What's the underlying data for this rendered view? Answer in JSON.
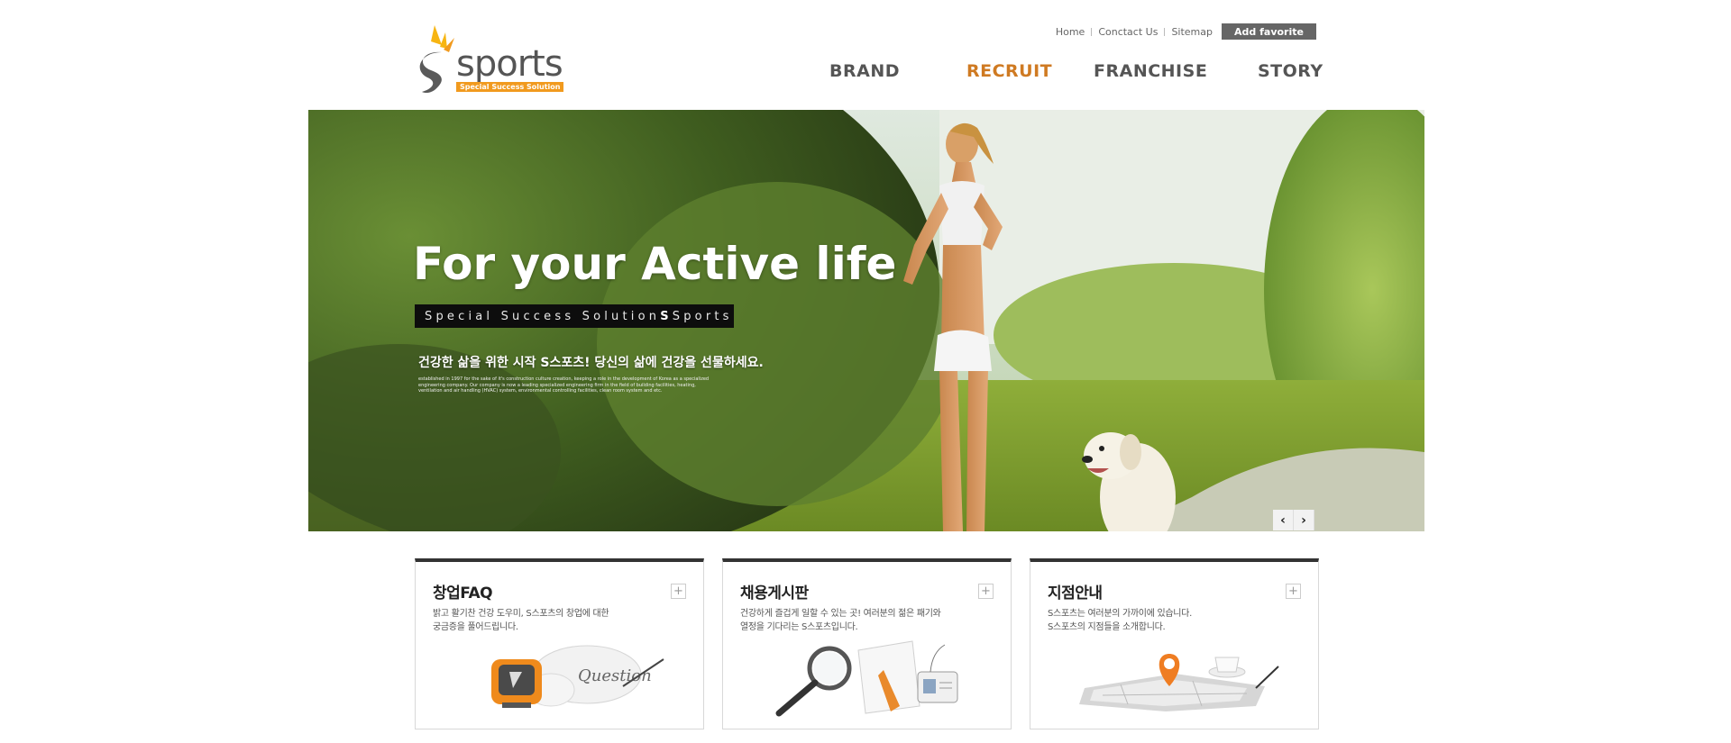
{
  "header": {
    "logo_text": "sports",
    "logo_tagline": "Special Success Solution",
    "util_links": [
      "Home",
      "Conctact Us",
      "Sitemap"
    ],
    "fav_label": "Add favorite",
    "nav": [
      {
        "label": "BRAND",
        "active": false
      },
      {
        "label": "RECRUIT",
        "active": true
      },
      {
        "label": "FRANCHISE",
        "active": false
      },
      {
        "label": "STORY",
        "active": false
      }
    ]
  },
  "hero": {
    "title": "For your Active life",
    "tag_prefix": "Special Success Solution ",
    "tag_bold": "S",
    "tag_suffix": " Sports",
    "subtitle": "건강한 삶을 위한 시작 S스포츠! 당신의 삶에 건강을 선물하세요.",
    "description": "established in 1997 for the sake of it's construction culture creation, keeping a role in the development of Korea as a specialized engineering company. Our company is now a leading specialized engineering firm in the field of building facilities, heating, ventilation and air handling (HVAC) system, environmental controlling facilities, clean room system and etc.",
    "prev_label": "‹",
    "next_label": "›"
  },
  "cards": [
    {
      "title": "창업FAQ",
      "line1": "밝고 활기찬 건강 도우미, S스포츠의 창업에 대한",
      "line2": "궁금증을 풀어드립니다.",
      "plus": "+",
      "art_text": "Question"
    },
    {
      "title": "채용게시판",
      "line1": "건강하게 즐겁게 일할 수 있는 곳! 여러분의 젊은 패기와",
      "line2": "열정을 기다리는 S스포츠입니다.",
      "plus": "+"
    },
    {
      "title": "지점안내",
      "line1": "S스포츠는 여러분의 가까이에 있습니다.",
      "line2": "S스포츠의 지점들을 소개합니다.",
      "plus": "+"
    }
  ],
  "colors": {
    "accent": "#cf7a22",
    "logo_orange": "#f19a1e",
    "card_top": "#333333"
  }
}
